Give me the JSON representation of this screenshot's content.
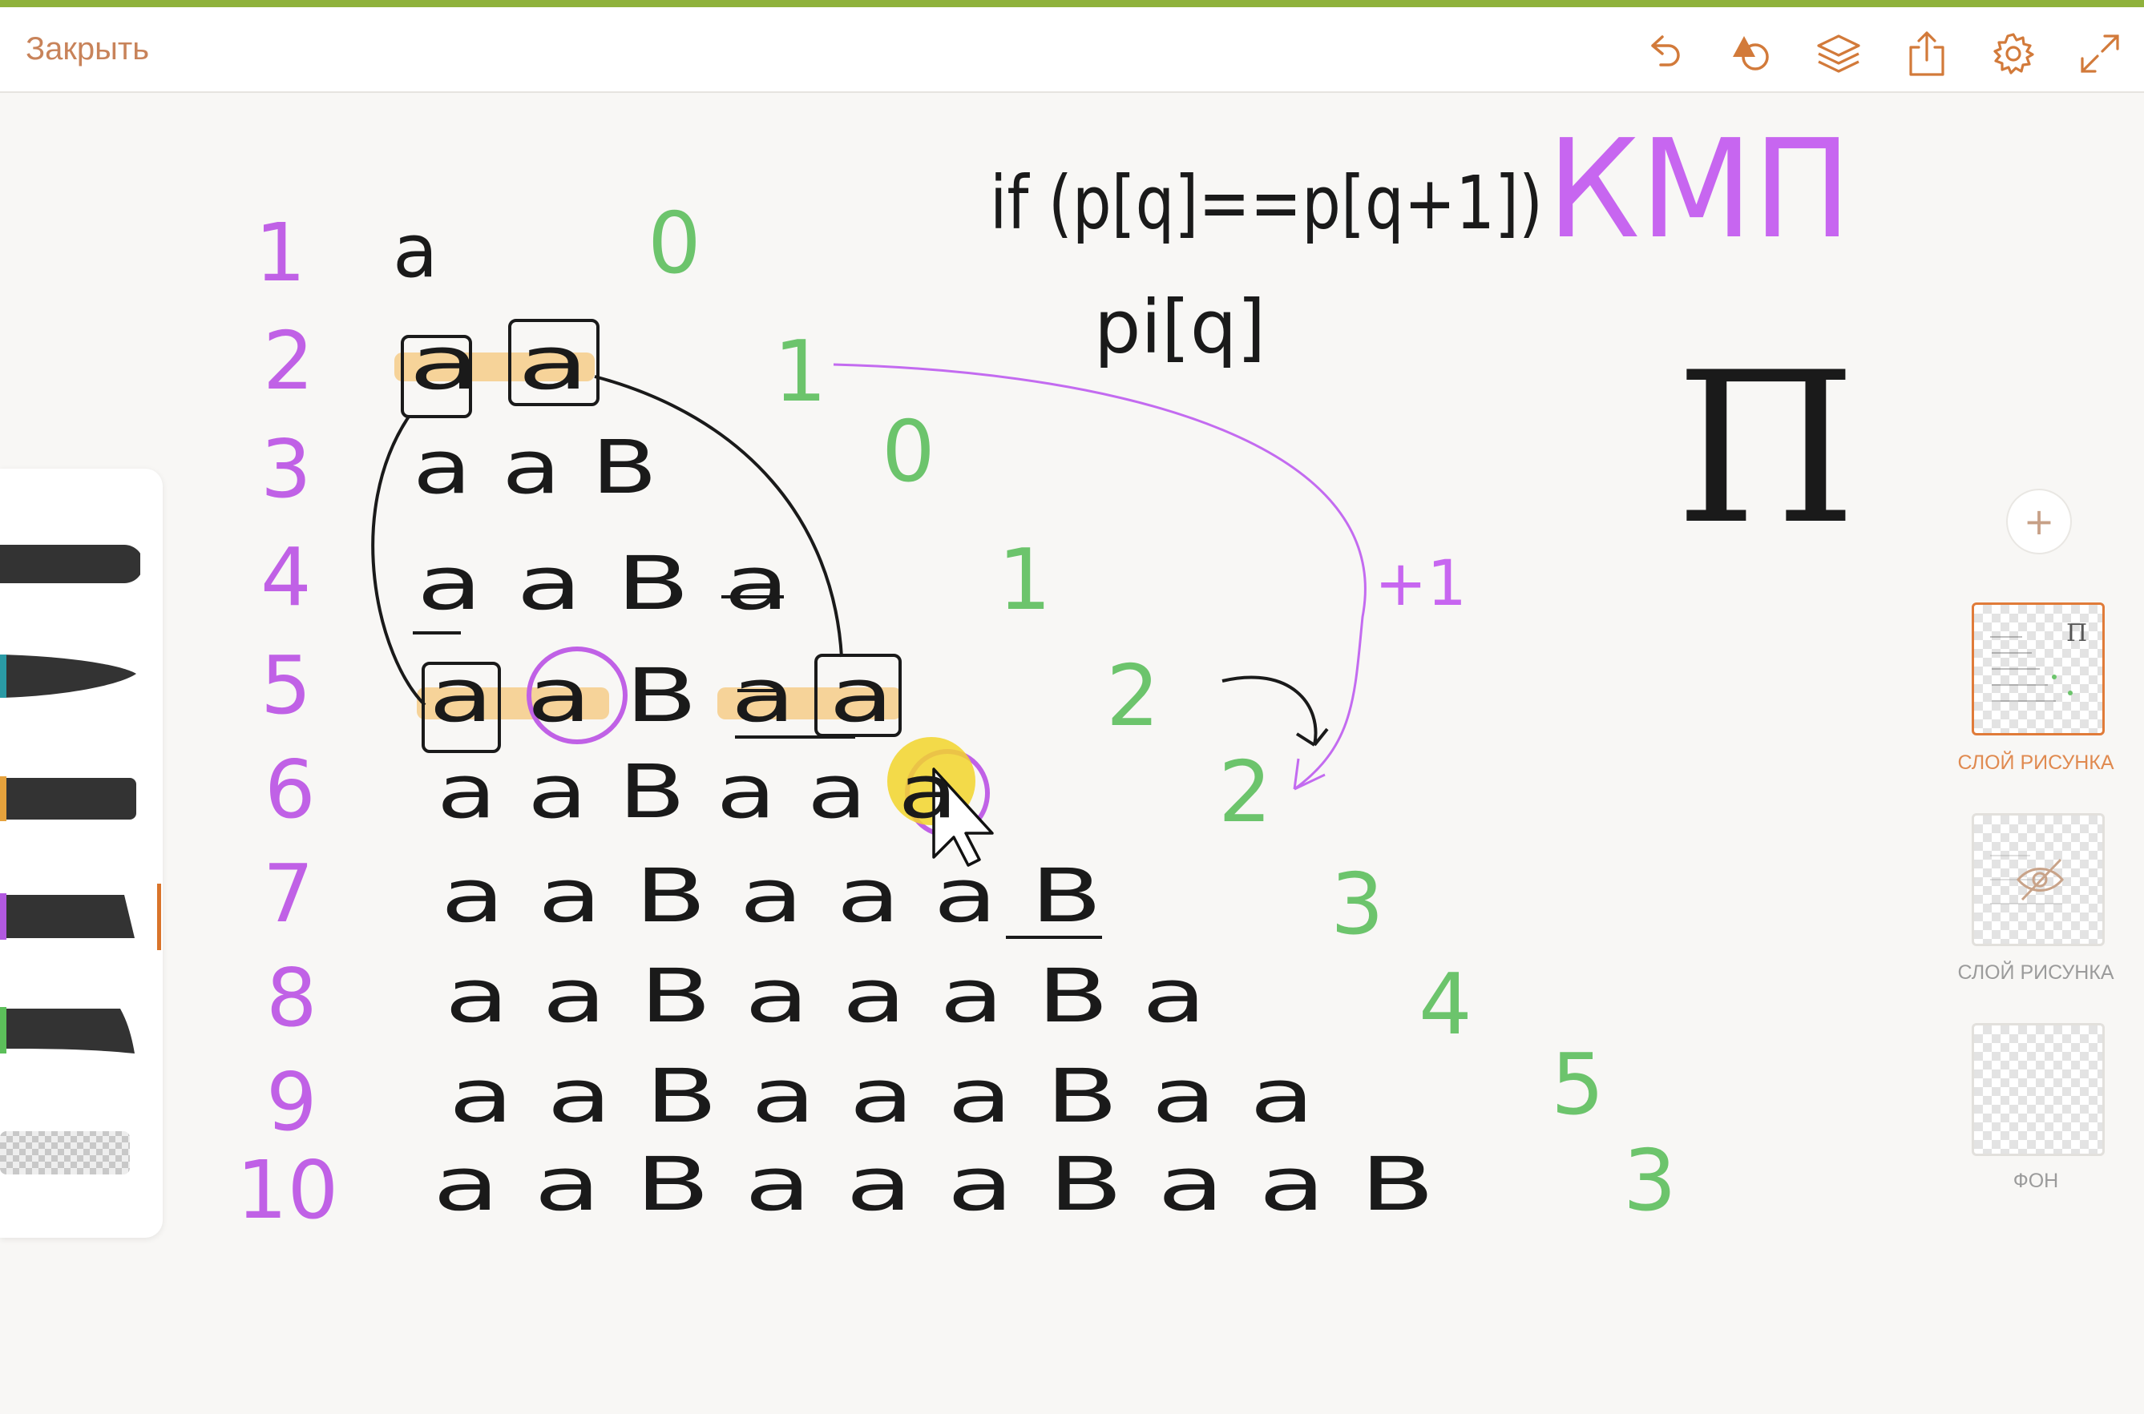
{
  "toolbar": {
    "close_label": "Закрыть",
    "icons": [
      "undo-icon",
      "shapes-icon",
      "layers-icon",
      "share-icon",
      "settings-icon",
      "fullscreen-icon"
    ]
  },
  "canvas": {
    "row_numbers": [
      "1",
      "2",
      "3",
      "4",
      "5",
      "6",
      "7",
      "8",
      "9",
      "10"
    ],
    "rows": [
      "a",
      "a a",
      "a a B",
      "a a B a",
      "a a B a a",
      "a a B a a a",
      "a a B a a a B",
      "a a B a a a B a",
      "a a B a a a B a a",
      "a a B a a a B a a B"
    ],
    "pi_values": [
      "0",
      "1",
      "0",
      "1",
      "2",
      "2",
      "3",
      "4",
      "5",
      "3"
    ],
    "formula_line1": "if (p[q]==p[q+1])",
    "formula_line2": "pi[q]",
    "title": "КМП",
    "pi_symbol": "Π",
    "plus_one": "+1"
  },
  "layers": [
    {
      "label": "СЛОЙ РИСУНКА",
      "active": true
    },
    {
      "label": "СЛОЙ РИСУНКА",
      "active": false,
      "hidden": true
    },
    {
      "label": "ФОН",
      "active": false
    }
  ],
  "colors": {
    "accent_green": "#8fb23c",
    "row_number_purple": "#c061e6",
    "pi_green": "#6cc46c",
    "title_purple": "#c766f0",
    "highlight": "#f5c77a",
    "ink": "#1a1a1a",
    "layer_active": "#e07b39"
  }
}
